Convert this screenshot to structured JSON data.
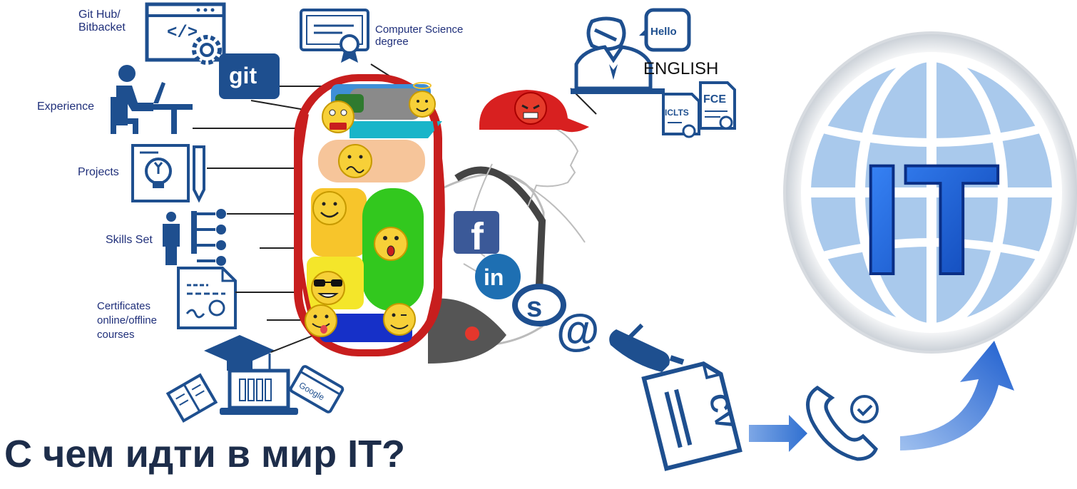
{
  "labels": {
    "github": "Git Hub/\nBitbacket",
    "github_line1": "Git Hub/",
    "github_line2": "Bitbacket",
    "cs_line1": "Computer Science",
    "cs_line2": "degree",
    "experience": "Experience",
    "projects": "Projects",
    "skills": "Skills Set",
    "cert_line1": "Certificates",
    "cert_line2": "online/offline",
    "cert_line3": "courses",
    "english": "ENGLISH"
  },
  "icons": {
    "git": "git",
    "code": "</>",
    "hello": "Hello",
    "iclts": "ICLTS",
    "fce": "FCE",
    "cv": "CV",
    "google": "Google",
    "it": "IT",
    "facebook": "f",
    "linkedin": "in",
    "skype": "s",
    "at": "@"
  },
  "title": "С чем идти в мир IT?",
  "colors": {
    "navy": "#1e4f8f",
    "label": "#1f2f7a",
    "globe_fill": "#a9c9ec",
    "it_blue": "#1565e0",
    "emoji": "#f7d038"
  }
}
